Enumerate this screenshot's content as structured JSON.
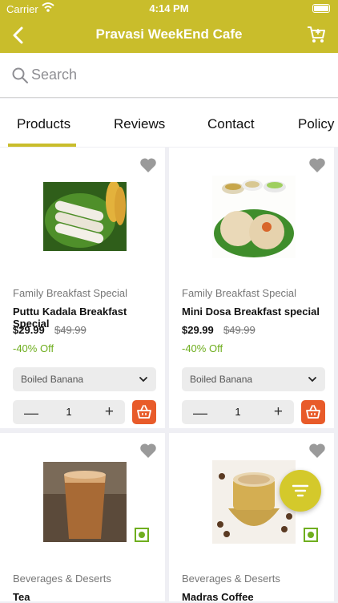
{
  "status_bar": {
    "carrier": "Carrier",
    "time": "4:14 PM"
  },
  "nav": {
    "title": "Pravasi WeekEnd Cafe"
  },
  "search": {
    "placeholder": "Search"
  },
  "tabs": [
    {
      "label": "Products",
      "active": true
    },
    {
      "label": "Reviews"
    },
    {
      "label": "Contact"
    },
    {
      "label": "Policy"
    }
  ],
  "products": [
    {
      "category": "Family Breakfast Special",
      "name": "Puttu Kadala Breakfast Special",
      "price": "$29.99",
      "old_price": "$49.99",
      "discount": "-40% Off",
      "option": "Boiled Banana",
      "quantity": "1"
    },
    {
      "category": "Family Breakfast Special",
      "name": "Mini Dosa Breakfast special",
      "price": "$29.99",
      "old_price": "$49.99",
      "discount": "-40% Off",
      "option": "Boiled Banana",
      "quantity": "1"
    },
    {
      "category": "Beverages & Deserts",
      "name": "Tea"
    },
    {
      "category": "Beverages & Deserts",
      "name": "Madras Coffee"
    }
  ],
  "colors": {
    "brand": "#c9bd2b",
    "basket": "#e85b2a",
    "discount": "#6fae1f"
  }
}
